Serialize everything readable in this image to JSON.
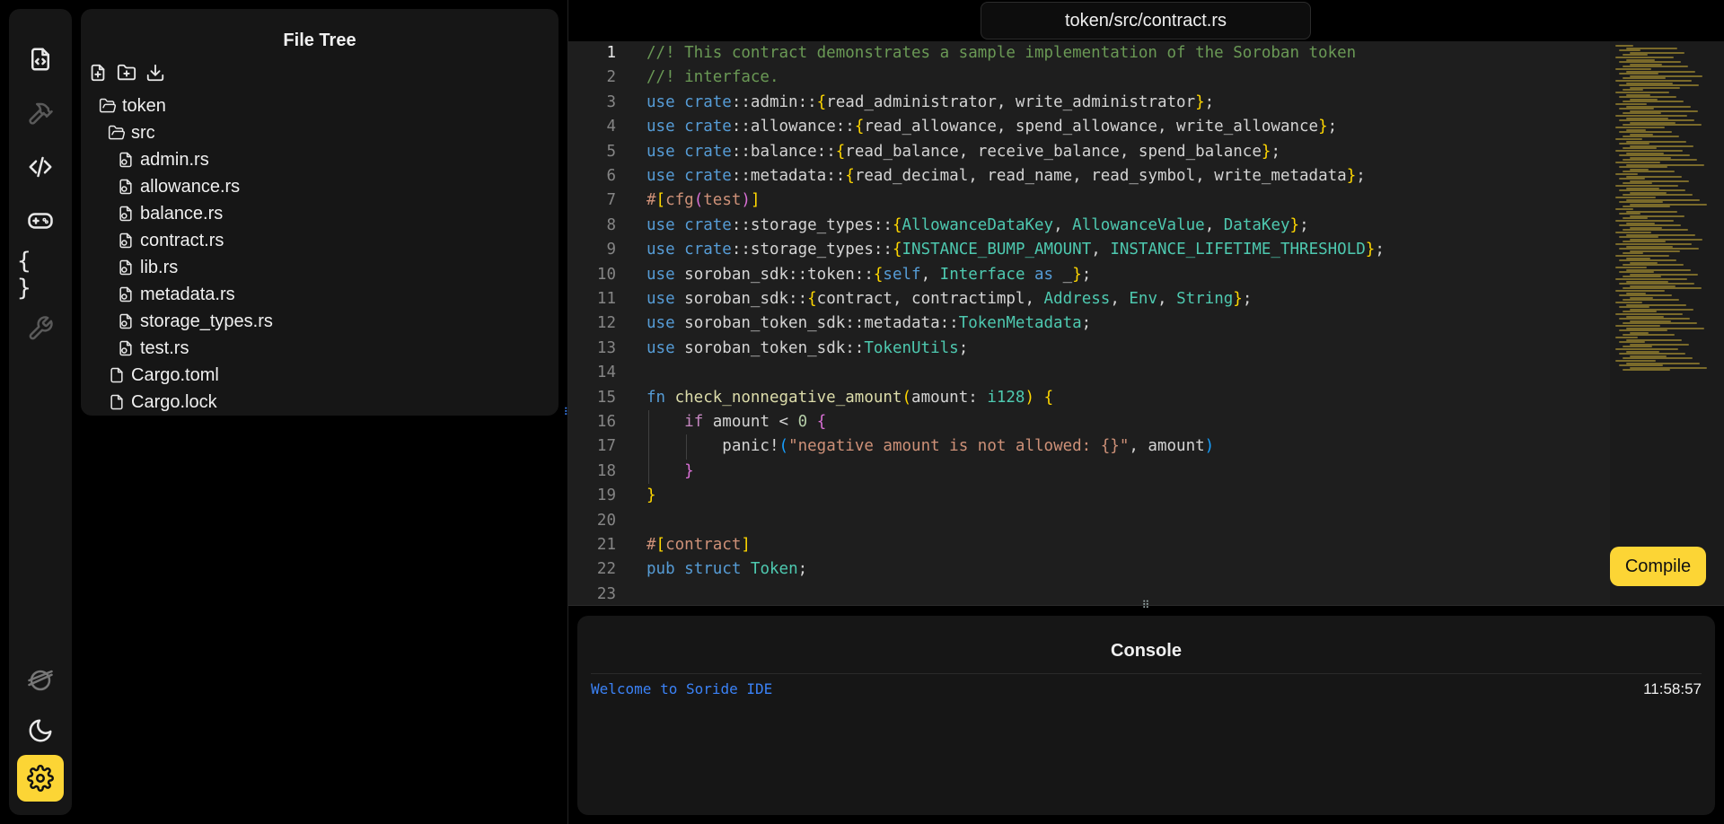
{
  "sidebar": {
    "items": [
      {
        "name": "file-explorer-icon"
      },
      {
        "name": "build-hammer-icon"
      },
      {
        "name": "code-icon"
      },
      {
        "name": "gamepad-icon"
      },
      {
        "name": "json-braces-icon",
        "text": "{ }"
      },
      {
        "name": "wrench-icon"
      },
      {
        "name": "stellar-logo-icon"
      },
      {
        "name": "moon-icon"
      },
      {
        "name": "settings-gear-icon"
      }
    ],
    "accent": "#fcd535"
  },
  "file_tree": {
    "title": "File Tree",
    "actions": [
      "new-file-icon",
      "new-folder-icon",
      "download-icon"
    ],
    "items": [
      {
        "label": "token",
        "type": "folder"
      },
      {
        "label": "src",
        "type": "folder"
      },
      {
        "label": "admin.rs",
        "type": "rust-file"
      },
      {
        "label": "allowance.rs",
        "type": "rust-file"
      },
      {
        "label": "balance.rs",
        "type": "rust-file"
      },
      {
        "label": "contract.rs",
        "type": "rust-file"
      },
      {
        "label": "lib.rs",
        "type": "rust-file"
      },
      {
        "label": "metadata.rs",
        "type": "rust-file"
      },
      {
        "label": "storage_types.rs",
        "type": "rust-file"
      },
      {
        "label": "test.rs",
        "type": "rust-file"
      },
      {
        "label": "Cargo.toml",
        "type": "file"
      },
      {
        "label": "Cargo.lock",
        "type": "file"
      }
    ]
  },
  "editor": {
    "tab_title": "token/src/contract.rs",
    "current_line": 1,
    "lines": [
      {
        "n": "1",
        "tokens": [
          [
            "c-cm",
            "//! This contract demonstrates a sample implementation of the Soroban token"
          ]
        ]
      },
      {
        "n": "2",
        "tokens": [
          [
            "c-cm",
            "//! interface."
          ]
        ]
      },
      {
        "n": "3",
        "tokens": [
          [
            "c-kw",
            "use "
          ],
          [
            "c-kw",
            "crate"
          ],
          [
            "c-var",
            "::admin::"
          ],
          [
            "c-br1",
            "{"
          ],
          [
            "c-var",
            "read_administrator, write_administrator"
          ],
          [
            "c-br1",
            "}"
          ],
          [
            "c-var",
            ";"
          ]
        ]
      },
      {
        "n": "4",
        "tokens": [
          [
            "c-kw",
            "use "
          ],
          [
            "c-kw",
            "crate"
          ],
          [
            "c-var",
            "::allowance::"
          ],
          [
            "c-br1",
            "{"
          ],
          [
            "c-var",
            "read_allowance, spend_allowance, write_allowance"
          ],
          [
            "c-br1",
            "}"
          ],
          [
            "c-var",
            ";"
          ]
        ]
      },
      {
        "n": "5",
        "tokens": [
          [
            "c-kw",
            "use "
          ],
          [
            "c-kw",
            "crate"
          ],
          [
            "c-var",
            "::balance::"
          ],
          [
            "c-br1",
            "{"
          ],
          [
            "c-var",
            "read_balance, receive_balance, spend_balance"
          ],
          [
            "c-br1",
            "}"
          ],
          [
            "c-var",
            ";"
          ]
        ]
      },
      {
        "n": "6",
        "tokens": [
          [
            "c-kw",
            "use "
          ],
          [
            "c-kw",
            "crate"
          ],
          [
            "c-var",
            "::metadata::"
          ],
          [
            "c-br1",
            "{"
          ],
          [
            "c-var",
            "read_decimal, read_name, read_symbol, write_metadata"
          ],
          [
            "c-br1",
            "}"
          ],
          [
            "c-var",
            ";"
          ]
        ]
      },
      {
        "n": "7",
        "tokens": [
          [
            "c-attr",
            "#"
          ],
          [
            "c-br1",
            "["
          ],
          [
            "c-attr",
            "cfg"
          ],
          [
            "c-br2",
            "("
          ],
          [
            "c-attr",
            "test"
          ],
          [
            "c-br2",
            ")"
          ],
          [
            "c-br1",
            "]"
          ]
        ]
      },
      {
        "n": "8",
        "tokens": [
          [
            "c-kw",
            "use "
          ],
          [
            "c-kw",
            "crate"
          ],
          [
            "c-var",
            "::storage_types::"
          ],
          [
            "c-br1",
            "{"
          ],
          [
            "c-ty",
            "AllowanceDataKey"
          ],
          [
            "c-var",
            ", "
          ],
          [
            "c-ty",
            "AllowanceValue"
          ],
          [
            "c-var",
            ", "
          ],
          [
            "c-ty",
            "DataKey"
          ],
          [
            "c-br1",
            "}"
          ],
          [
            "c-var",
            ";"
          ]
        ]
      },
      {
        "n": "9",
        "tokens": [
          [
            "c-kw",
            "use "
          ],
          [
            "c-kw",
            "crate"
          ],
          [
            "c-var",
            "::storage_types::"
          ],
          [
            "c-br1",
            "{"
          ],
          [
            "c-ty",
            "INSTANCE_BUMP_AMOUNT"
          ],
          [
            "c-var",
            ", "
          ],
          [
            "c-ty",
            "INSTANCE_LIFETIME_THRESHOLD"
          ],
          [
            "c-br1",
            "}"
          ],
          [
            "c-var",
            ";"
          ]
        ]
      },
      {
        "n": "10",
        "tokens": [
          [
            "c-kw",
            "use "
          ],
          [
            "c-var",
            "soroban_sdk::token::"
          ],
          [
            "c-br1",
            "{"
          ],
          [
            "c-kw",
            "self"
          ],
          [
            "c-var",
            ", "
          ],
          [
            "c-ty",
            "Interface"
          ],
          [
            "c-kw",
            " as "
          ],
          [
            "c-var",
            "_"
          ],
          [
            "c-br1",
            "}"
          ],
          [
            "c-var",
            ";"
          ]
        ]
      },
      {
        "n": "11",
        "tokens": [
          [
            "c-kw",
            "use "
          ],
          [
            "c-var",
            "soroban_sdk::"
          ],
          [
            "c-br1",
            "{"
          ],
          [
            "c-var",
            "contract, contractimpl, "
          ],
          [
            "c-ty",
            "Address"
          ],
          [
            "c-var",
            ", "
          ],
          [
            "c-ty",
            "Env"
          ],
          [
            "c-var",
            ", "
          ],
          [
            "c-ty",
            "String"
          ],
          [
            "c-br1",
            "}"
          ],
          [
            "c-var",
            ";"
          ]
        ]
      },
      {
        "n": "12",
        "tokens": [
          [
            "c-kw",
            "use "
          ],
          [
            "c-var",
            "soroban_token_sdk::metadata::"
          ],
          [
            "c-ty",
            "TokenMetadata"
          ],
          [
            "c-var",
            ";"
          ]
        ]
      },
      {
        "n": "13",
        "tokens": [
          [
            "c-kw",
            "use "
          ],
          [
            "c-var",
            "soroban_token_sdk::"
          ],
          [
            "c-ty",
            "TokenUtils"
          ],
          [
            "c-var",
            ";"
          ]
        ]
      },
      {
        "n": "14",
        "tokens": []
      },
      {
        "n": "15",
        "tokens": [
          [
            "c-kw",
            "fn "
          ],
          [
            "c-fn",
            "check_nonnegative_amount"
          ],
          [
            "c-br1",
            "("
          ],
          [
            "c-var",
            "amount: "
          ],
          [
            "c-ty",
            "i128"
          ],
          [
            "c-br1",
            ")"
          ],
          [
            "c-var",
            " "
          ],
          [
            "c-br1",
            "{"
          ]
        ]
      },
      {
        "n": "16",
        "tokens": [
          [
            "c-var",
            "    "
          ],
          [
            "c-kwb",
            "if "
          ],
          [
            "c-var",
            "amount < "
          ],
          [
            "c-num",
            "0"
          ],
          [
            "c-var",
            " "
          ],
          [
            "c-br2",
            "{"
          ]
        ]
      },
      {
        "n": "17",
        "tokens": [
          [
            "c-var",
            "        panic!"
          ],
          [
            "c-br3",
            "("
          ],
          [
            "c-str",
            "\"negative amount is not allowed: {}\""
          ],
          [
            "c-var",
            ", amount"
          ],
          [
            "c-br3",
            ")"
          ]
        ]
      },
      {
        "n": "18",
        "tokens": [
          [
            "c-var",
            "    "
          ],
          [
            "c-br2",
            "}"
          ]
        ]
      },
      {
        "n": "19",
        "tokens": [
          [
            "c-br1",
            "}"
          ]
        ]
      },
      {
        "n": "20",
        "tokens": []
      },
      {
        "n": "21",
        "tokens": [
          [
            "c-attr",
            "#"
          ],
          [
            "c-br1",
            "["
          ],
          [
            "c-attr",
            "contract"
          ],
          [
            "c-br1",
            "]"
          ]
        ]
      },
      {
        "n": "22",
        "tokens": [
          [
            "c-kw",
            "pub "
          ],
          [
            "c-kw",
            "struct "
          ],
          [
            "c-ty",
            "Token"
          ],
          [
            "c-var",
            ";"
          ]
        ]
      },
      {
        "n": "23",
        "tokens": []
      }
    ],
    "compile_label": "Compile"
  },
  "console": {
    "title": "Console",
    "message": "Welcome to Soride IDE",
    "timestamp": "11:58:57",
    "message_color": "#3b82f6"
  }
}
